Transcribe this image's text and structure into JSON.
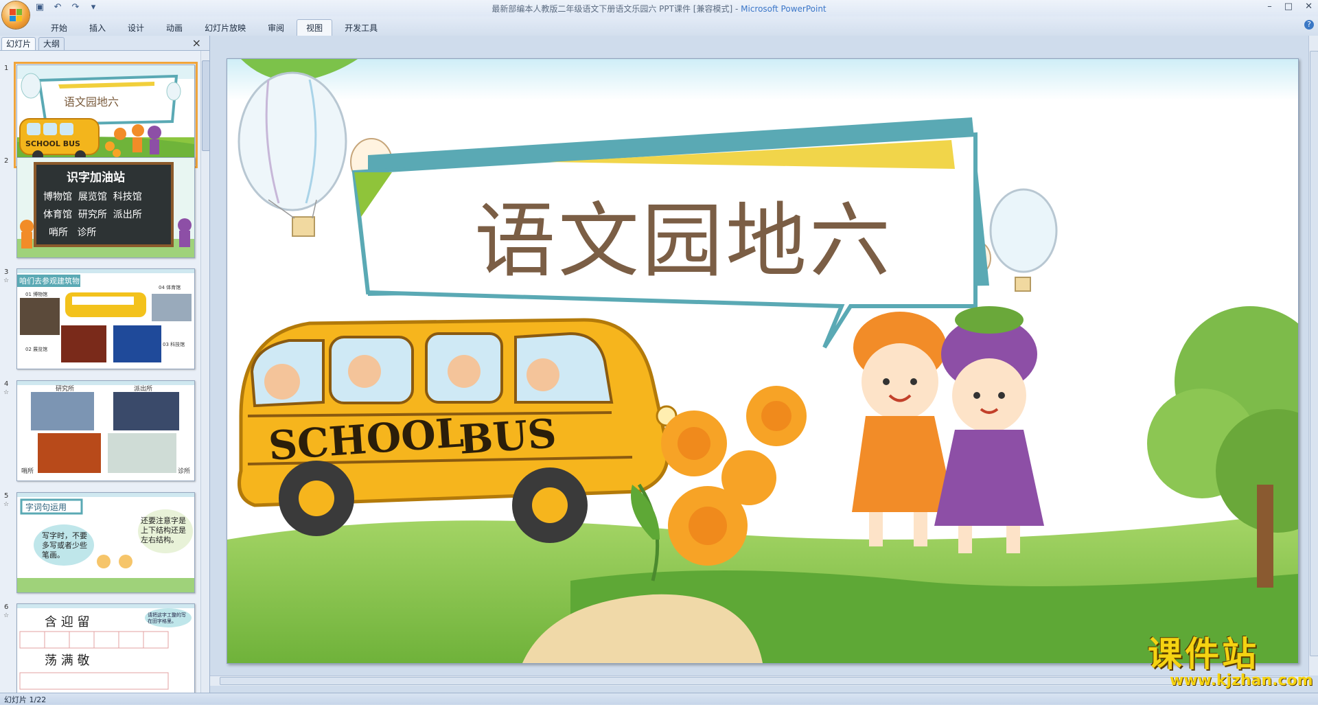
{
  "window": {
    "title": "最新部编本人教版二年级语文下册语文乐园六 PPT课件 [兼容模式] - ",
    "app": "Microsoft PowerPoint",
    "controls": [
      "–",
      "□",
      "✕"
    ]
  },
  "ribbon": {
    "tabs": [
      "开始",
      "插入",
      "设计",
      "动画",
      "幻灯片放映",
      "审阅",
      "视图",
      "开发工具"
    ],
    "active_tab": "视图"
  },
  "pane": {
    "tab_slides": "幻灯片",
    "tab_outline": "大纲",
    "close": "×"
  },
  "thumbnails": [
    {
      "num": "1",
      "title": "语文园地六"
    },
    {
      "num": "2",
      "title": "识字加油站",
      "lines": [
        "博物馆  展览馆  科技馆",
        "体育馆  研究所  派出所",
        "哨所   诊所"
      ]
    },
    {
      "num": "3",
      "anim": "☆",
      "title": "咱们去参观建筑物",
      "labels": [
        "01 博物馆",
        "02 展览馆",
        "03 科技馆",
        "04 体育馆"
      ]
    },
    {
      "num": "4",
      "anim": "☆",
      "labels": [
        "研究所",
        "派出所",
        "哨所",
        "诊所"
      ]
    },
    {
      "num": "5",
      "anim": "☆",
      "title": "字词句运用",
      "bubble_left": "写字时，不要多写或者少些笔画。",
      "bubble_right": "还要注意字是上下结构还是左右结构。"
    },
    {
      "num": "6",
      "anim": "☆",
      "row1": "含 迎 留",
      "row2": "荡 满 敬",
      "note": "请把这字工整的写在田字格里。"
    }
  ],
  "slide": {
    "title": "语文园地六",
    "bus_text_1": "SCHOOL",
    "bus_text_2": "BUS"
  },
  "status": {
    "text": "幻灯片 1/22"
  },
  "watermark": {
    "big": "课件站",
    "url": "www.kjzhan.com"
  }
}
